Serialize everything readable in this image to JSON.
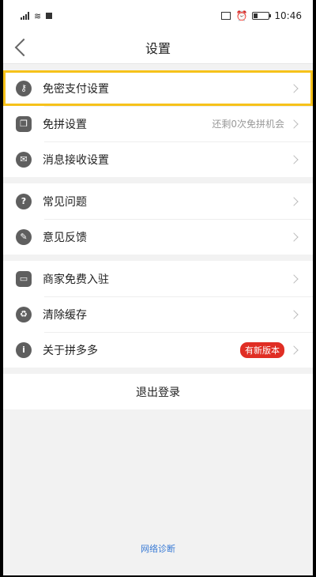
{
  "status": {
    "time": "10:46"
  },
  "nav": {
    "title": "设置"
  },
  "groups": [
    {
      "rows": [
        {
          "label": "免密支付设置",
          "icon": "key-icon"
        },
        {
          "label": "免拼设置",
          "sub": "还剩0次免拼机会",
          "icon": "copy-icon"
        },
        {
          "label": "消息接收设置",
          "icon": "message-icon"
        }
      ]
    },
    {
      "rows": [
        {
          "label": "常见问题",
          "icon": "question-icon"
        },
        {
          "label": "意见反馈",
          "icon": "edit-icon"
        }
      ]
    },
    {
      "rows": [
        {
          "label": "商家免费入驻",
          "icon": "store-icon"
        },
        {
          "label": "清除缓存",
          "icon": "trash-icon"
        },
        {
          "label": "关于拼多多",
          "badge": "有新版本",
          "icon": "info-icon"
        }
      ]
    }
  ],
  "logout": "退出登录",
  "footer": {
    "link": "网络诊断"
  },
  "colors": {
    "highlight": "#f6c21a",
    "badge": "#e02e24",
    "link": "#3a7bd5"
  }
}
